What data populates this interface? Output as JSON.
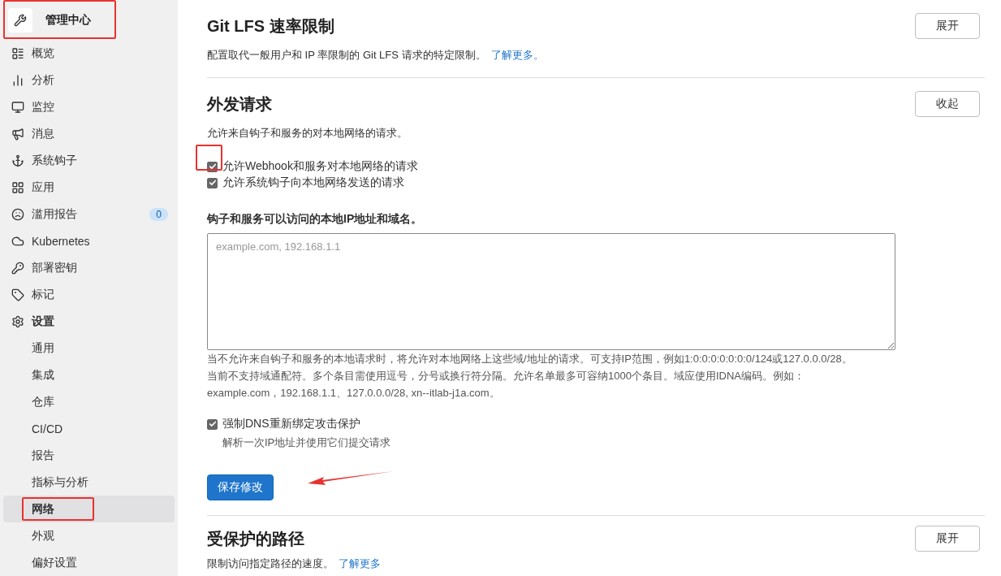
{
  "sidebar": {
    "header": {
      "title": "管理中心",
      "highlighted": true
    },
    "items": [
      {
        "label": "概览"
      },
      {
        "label": "分析"
      },
      {
        "label": "监控"
      },
      {
        "label": "消息"
      },
      {
        "label": "系统钩子"
      },
      {
        "label": "应用"
      },
      {
        "label": "滥用报告",
        "badge": "0"
      },
      {
        "label": "Kubernetes"
      },
      {
        "label": "部署密钥"
      },
      {
        "label": "标记"
      },
      {
        "label": "设置",
        "expanded": true,
        "children": [
          {
            "label": "通用",
            "selected": false,
            "highlighted": false
          },
          {
            "label": "集成",
            "selected": false,
            "highlighted": false
          },
          {
            "label": "仓库",
            "selected": false,
            "highlighted": false
          },
          {
            "label": "CI/CD",
            "selected": false,
            "highlighted": false
          },
          {
            "label": "报告",
            "selected": false,
            "highlighted": false
          },
          {
            "label": "指标与分析",
            "selected": false,
            "highlighted": false
          },
          {
            "label": "网络",
            "selected": true,
            "highlighted": true
          },
          {
            "label": "外观",
            "selected": false,
            "highlighted": false
          },
          {
            "label": "偏好设置",
            "selected": false,
            "highlighted": false
          }
        ]
      }
    ]
  },
  "sections": [
    {
      "title": "Git LFS 速率限制",
      "description": "配置取代一般用户和 IP 率限制的 Git LFS 请求的特定限制。",
      "link": "了解更多。",
      "toggle": "展开"
    },
    {
      "title": "外发请求",
      "description": "允许来自钩子和服务的对本地网络的请求。",
      "toggle": "收起",
      "checkboxes": [
        {
          "label": "允许Webhook和服务对本地网络的请求",
          "checked": true,
          "highlighted": true
        },
        {
          "label": "允许系统钩子向本地网络发送的请求",
          "checked": true,
          "highlighted": false
        }
      ],
      "allowlist": {
        "label": "钩子和服务可以访问的本地IP地址和域名。",
        "placeholder": "example.com, 192.168.1.1",
        "help": [
          "当不允许来自钩子和服务的本地请求时，将允许对本地网络上这些域/地址的请求。可支持IP范围，例如1:0:0:0:0:0:0:0/124或127.0.0.0/28。",
          "当前不支持域通配符。多个条目需使用逗号，分号或换行符分隔。允许名单最多可容纳1000个条目。域应使用IDNA编码。例如：",
          "example.com，192.168.1.1、127.0.0.0/28, xn--itlab-j1a.com。"
        ]
      },
      "dns": {
        "label": "强制DNS重新绑定攻击保护",
        "hint": "解析一次IP地址并使用它们提交请求",
        "checked": true
      },
      "save": {
        "label": "保存修改",
        "arrow": true
      }
    },
    {
      "title": "受保护的路径",
      "description": "限制访问指定路径的速度。",
      "link": "了解更多",
      "toggle": "展开"
    }
  ]
}
